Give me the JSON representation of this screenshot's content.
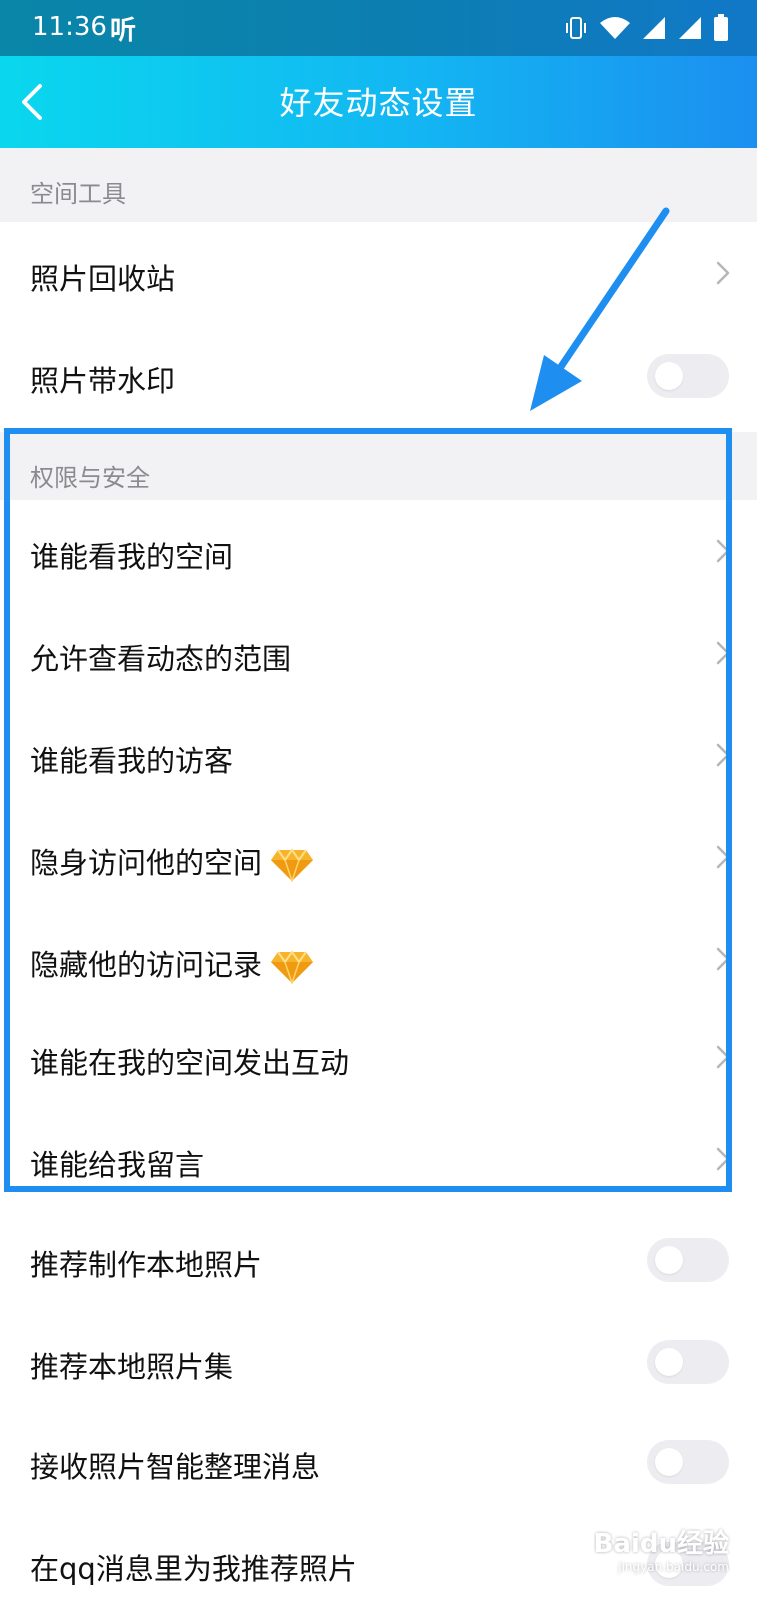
{
  "status_bar": {
    "time": "11:36",
    "ting": "听",
    "icons": [
      "vibrate-icon",
      "wifi-icon",
      "signal-icon",
      "signal-icon",
      "battery-icon"
    ]
  },
  "header": {
    "title": "好友动态设置"
  },
  "sections": {
    "tools_title": "空间工具",
    "permission_title": "权限与安全"
  },
  "rows": {
    "photo_recycle": "照片回收站",
    "photo_watermark": "照片带水印",
    "who_can_see_space": "谁能看我的空间",
    "view_scope": "允许查看动态的范围",
    "who_can_see_visitors": "谁能看我的访客",
    "invisible_visit": "隐身访问他的空间",
    "hide_visit_record": "隐藏他的访问记录",
    "who_can_interact": "谁能在我的空间发出互动",
    "who_can_message": "谁能给我留言",
    "recommend_local_photos": "推荐制作本地照片",
    "recommend_photo_sets": "推荐本地照片集",
    "receive_smart_photo_msgs": "接收照片智能整理消息",
    "recommend_in_qq_msgs": "在qq消息里为我推荐照片"
  },
  "colors": {
    "header_gradient_start": "#0ad7ee",
    "header_gradient_end": "#1b8ff0",
    "highlight_border": "#1e8ff0",
    "section_bg": "#f2f2f5"
  },
  "watermark": {
    "brand": "Baidu经验",
    "sub": "jingyan.baidu.com"
  }
}
